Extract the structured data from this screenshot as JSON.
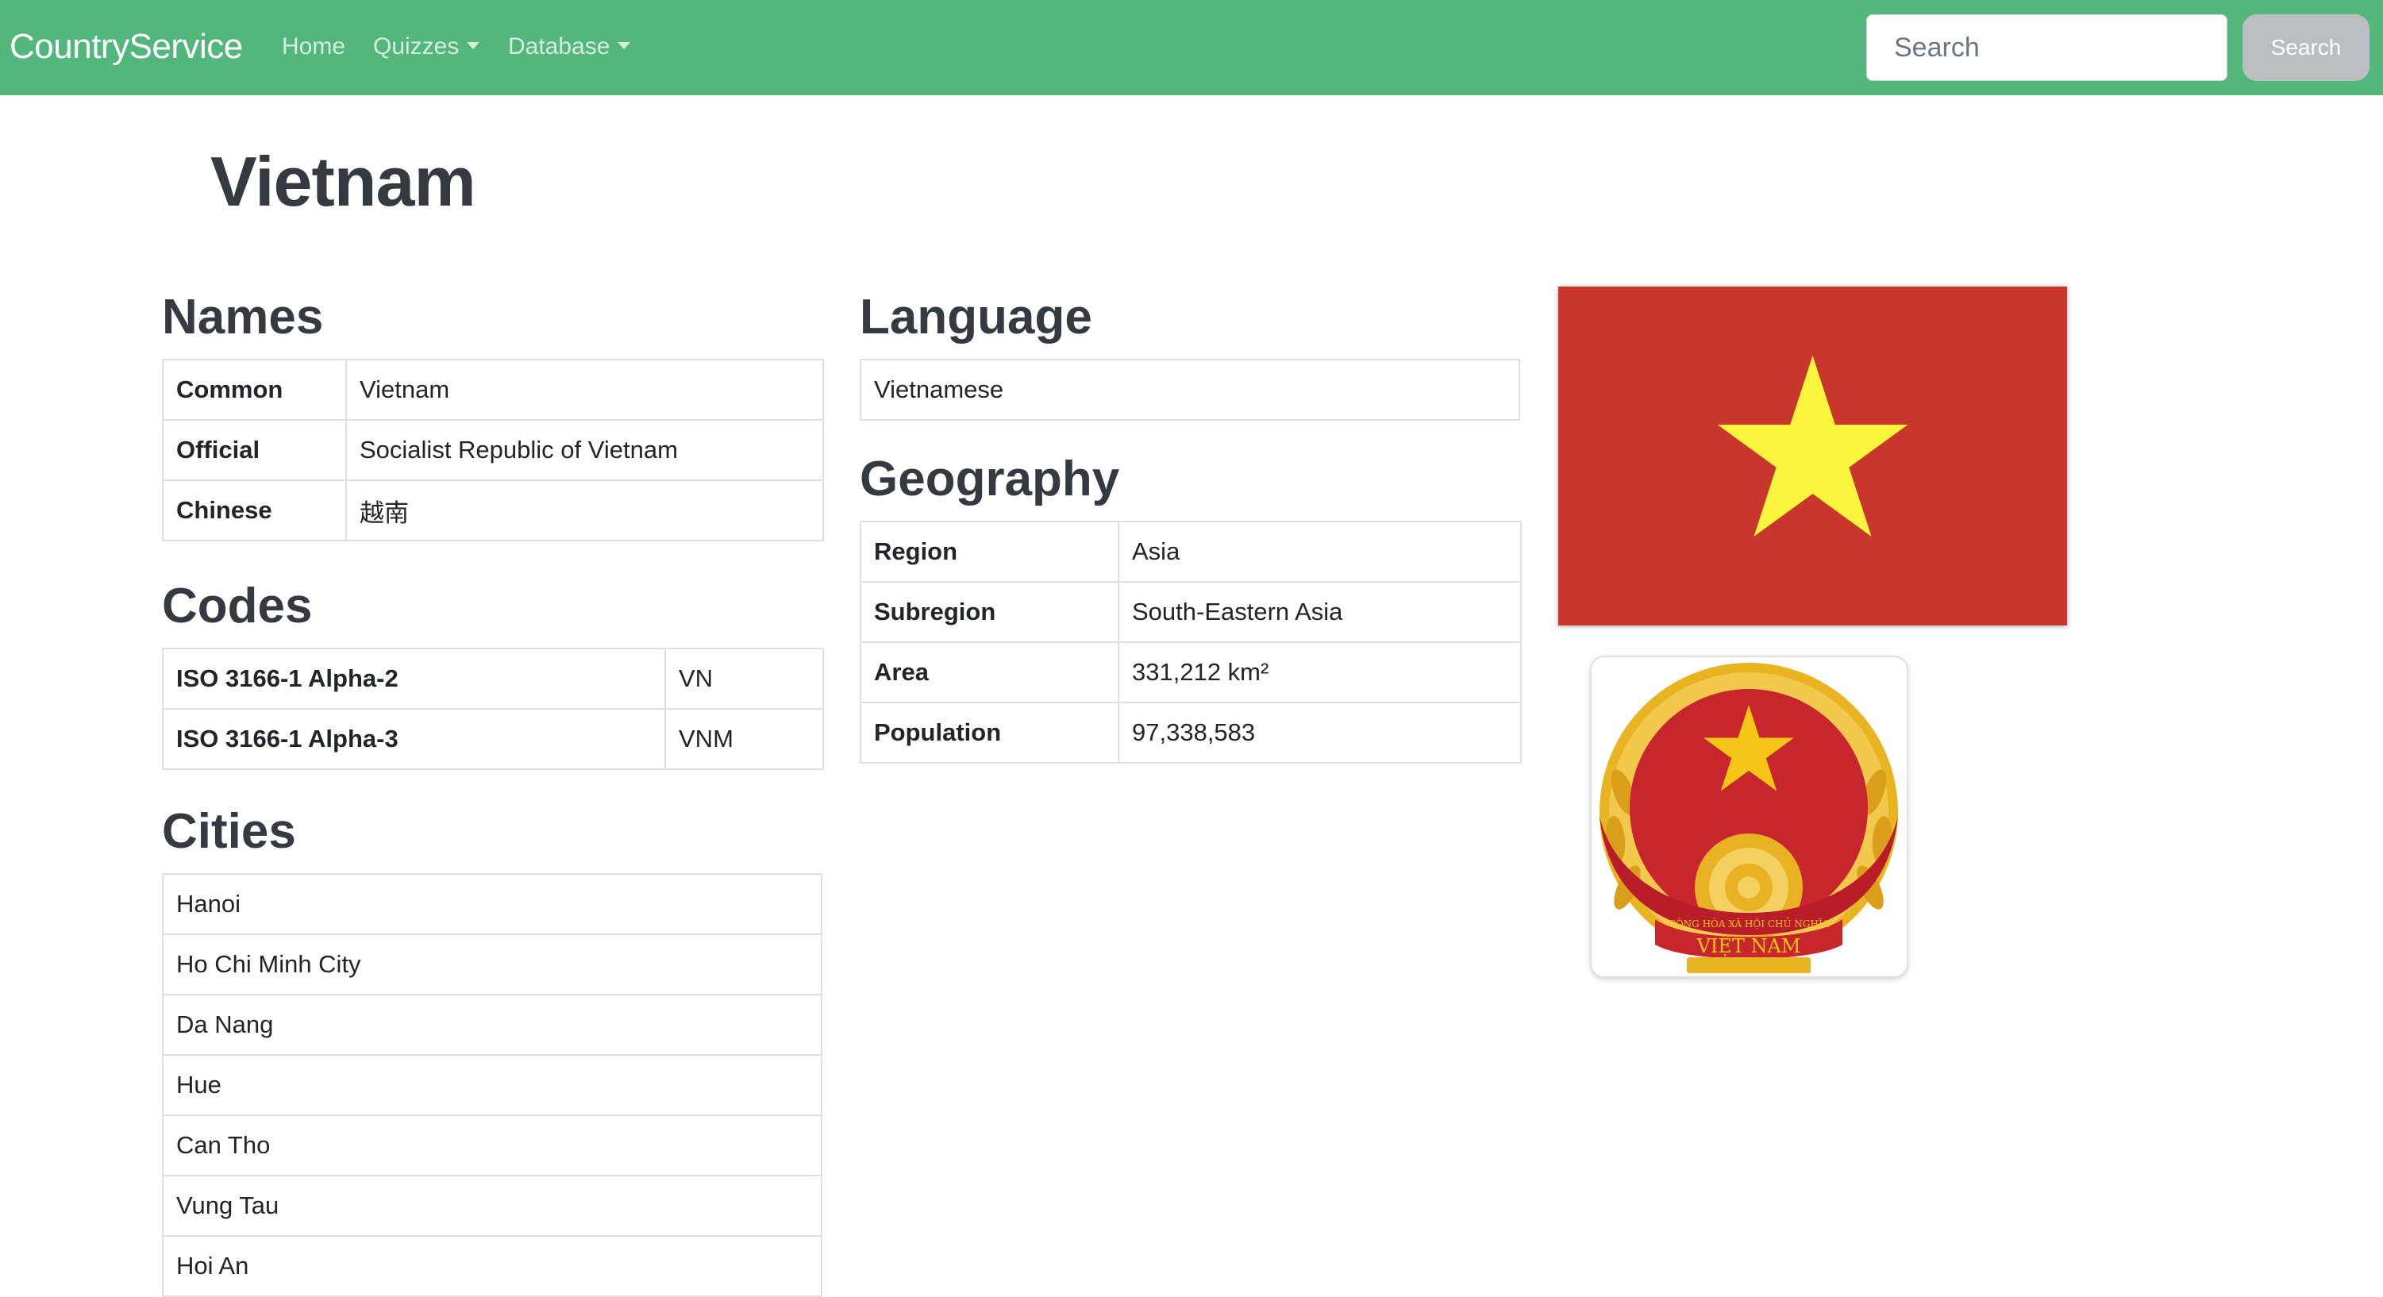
{
  "navbar": {
    "brand": "CountryService",
    "links": [
      {
        "label": "Home",
        "dropdown": false
      },
      {
        "label": "Quizzes",
        "dropdown": true
      },
      {
        "label": "Database",
        "dropdown": true
      }
    ],
    "search": {
      "placeholder": "Search",
      "value": "",
      "button_label": "Search"
    }
  },
  "country": {
    "title": "Vietnam"
  },
  "names": {
    "heading": "Names",
    "rows": [
      {
        "label": "Common",
        "value": "Vietnam"
      },
      {
        "label": "Official",
        "value": "Socialist Republic of Vietnam"
      },
      {
        "label": "Chinese",
        "value": "越南"
      }
    ]
  },
  "codes": {
    "heading": "Codes",
    "rows": [
      {
        "label": "ISO 3166-1 Alpha-2",
        "value": "VN"
      },
      {
        "label": "ISO 3166-1 Alpha-3",
        "value": "VNM"
      }
    ]
  },
  "cities": {
    "heading": "Cities",
    "items": [
      "Hanoi",
      "Ho Chi Minh City",
      "Da Nang",
      "Hue",
      "Can Tho",
      "Vung Tau",
      "Hoi An"
    ]
  },
  "language": {
    "heading": "Language",
    "items": [
      "Vietnamese"
    ]
  },
  "geography": {
    "heading": "Geography",
    "rows": [
      {
        "label": "Region",
        "value": "Asia"
      },
      {
        "label": "Subregion",
        "value": "South-Eastern Asia"
      },
      {
        "label": "Area",
        "value": "331,212 km²"
      },
      {
        "label": "Population",
        "value": "97,338,583"
      }
    ]
  },
  "images": {
    "flag_icon": "vietnam-flag",
    "emblem_icon": "vietnam-emblem",
    "emblem_text": [
      "CỘNG HÒA XÃ HỘI CHỦ NGHĨA",
      "VIỆT NAM"
    ]
  },
  "colors": {
    "navbar": "#53b77c",
    "flag_red": "#c9372c",
    "flag_star": "#f9f53d",
    "search_button": "#b9bec3"
  }
}
